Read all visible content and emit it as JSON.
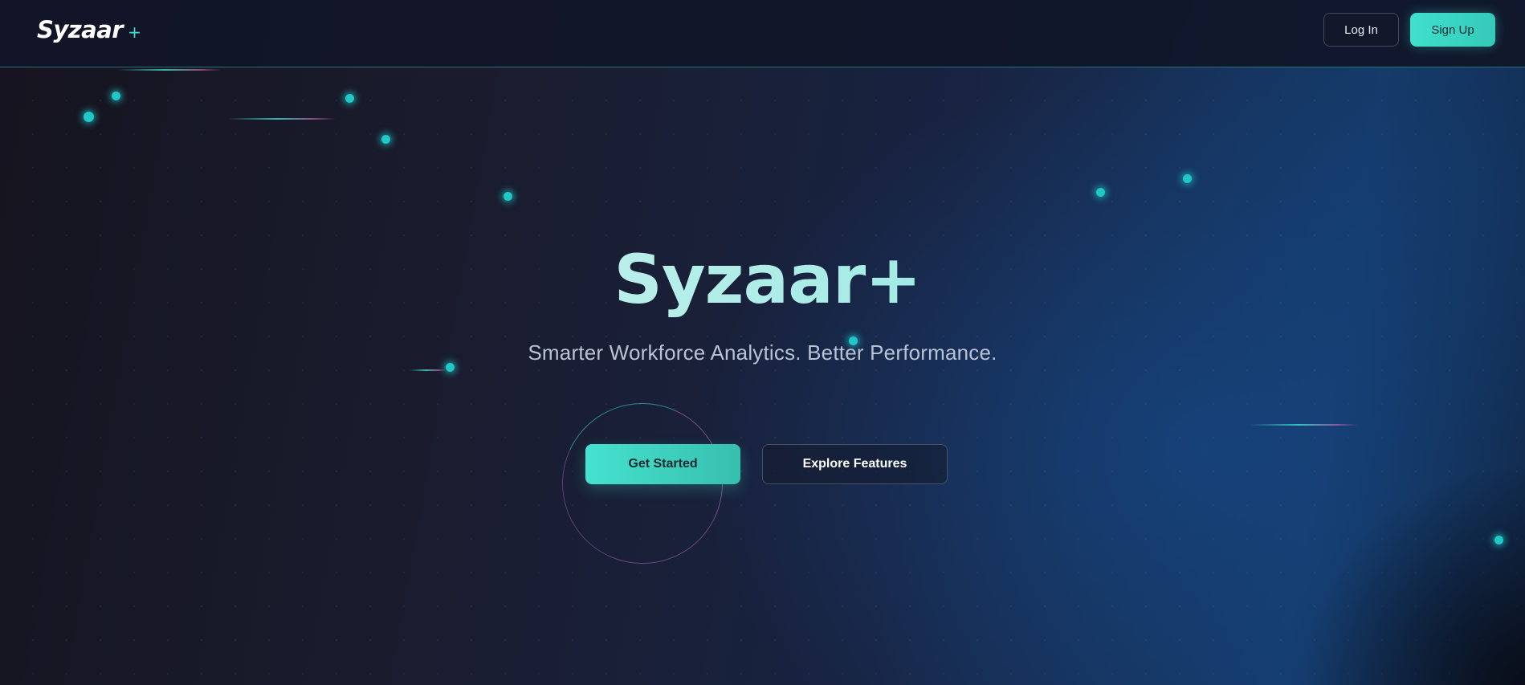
{
  "navbar": {
    "logo_text": "Syzaar",
    "logo_plus": "+",
    "login_label": "Log In",
    "signup_label": "Sign Up"
  },
  "hero": {
    "title": "Syzaar+",
    "subtitle": "Smarter Workforce Analytics. Better Performance.",
    "primary_cta": "Get Started",
    "secondary_cta": "Explore Features"
  },
  "colors": {
    "accent": "#40e0d0",
    "background": "#1a1c2e",
    "particle": "#20c8c8"
  }
}
